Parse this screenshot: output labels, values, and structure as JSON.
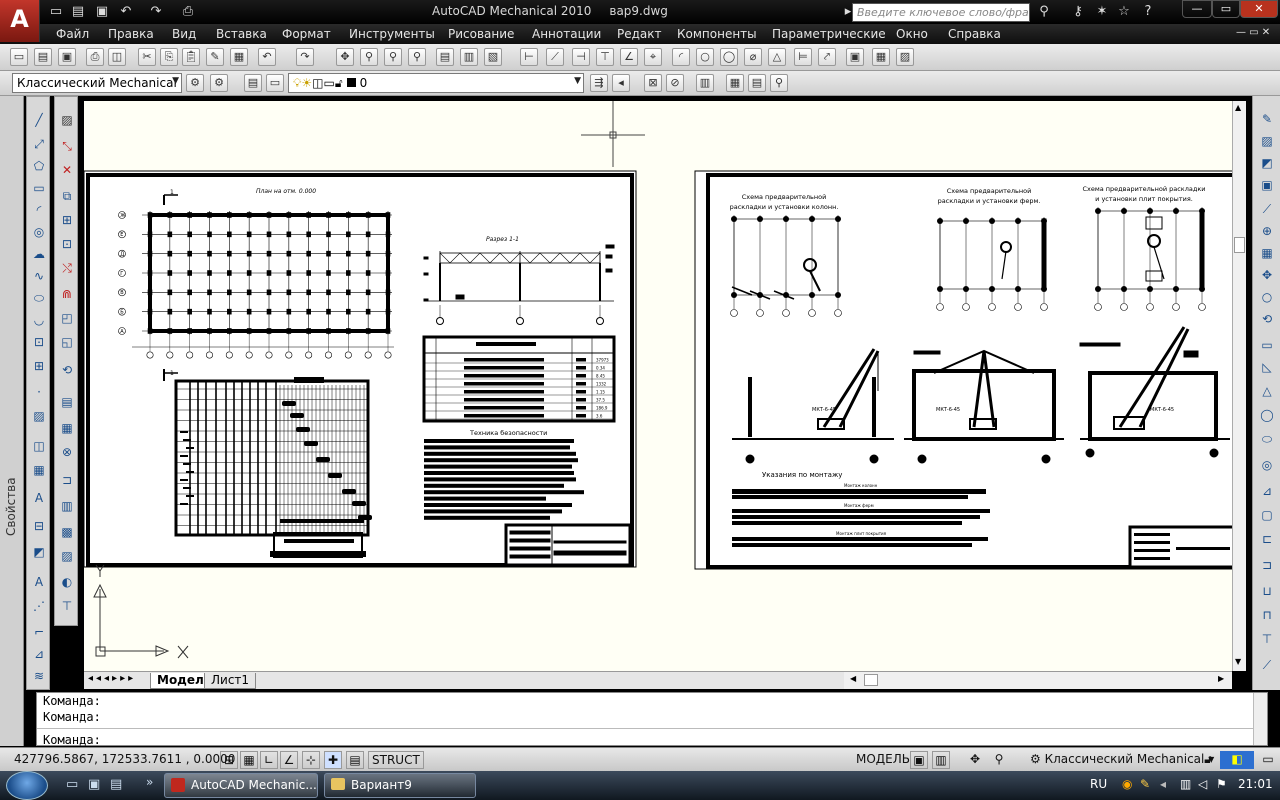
{
  "window": {
    "app_title": "AutoCAD Mechanical 2010",
    "file_name": "вар9.dwg",
    "search_placeholder": "Введите ключевое слово/фразу"
  },
  "menu": [
    "Файл",
    "Правка",
    "Вид",
    "Вставка",
    "Формат",
    "Инструменты",
    "Рисование",
    "Аннотации",
    "Редакт",
    "Компоненты",
    "Параметрические",
    "Окно",
    "Справка"
  ],
  "workspace": {
    "name": "Классический Mechanical"
  },
  "layer": {
    "name": "0"
  },
  "palette": {
    "properties_label": "Свойства"
  },
  "drawing": {
    "sheet1": {
      "plan_title": "План на отм. 0.000",
      "section_title": "Разрез 1-1",
      "cut_mark": "1",
      "safety_title": "Техника безопасности",
      "axis_labels": [
        "Ж",
        "Е",
        "Д",
        "Г",
        "В",
        "Б",
        "А"
      ],
      "table_values": [
        "37973",
        "0.34",
        "8.45",
        "1332",
        "1.15",
        "37.5",
        "186.9",
        "3.6"
      ]
    },
    "sheet2": {
      "scheme1_title": "Схема предварительной\nраскладки и установки колонн.",
      "scheme2_title": "Схема предварительной\nраскладки и установки ферм.",
      "scheme3_title": "Схема предварительной раскладки\nи установки плит покрытия.",
      "crane_labels": [
        "МКТ-6-45",
        "МКТ-6-45",
        "МКТ-6-45"
      ],
      "mount_title": "Указания по монтажу",
      "mount_sub": [
        "Монтаж колонн",
        "Монтаж ферм",
        "Монтаж плит покрытия"
      ]
    }
  },
  "layout_tabs": [
    "Модель",
    "Лист1"
  ],
  "command": {
    "lines": [
      "Команда:",
      "Команда:",
      "Команда:"
    ]
  },
  "status": {
    "coords": "427796.5867, 172533.7611 , 0.0000",
    "struct": "STRUCT",
    "model": "МОДЕЛЬ",
    "workspace": "Классический Mechanical"
  },
  "taskbar": {
    "items": [
      "AutoCAD Mechanic...",
      "Вариант9"
    ],
    "lang": "RU",
    "clock": "21:01"
  }
}
